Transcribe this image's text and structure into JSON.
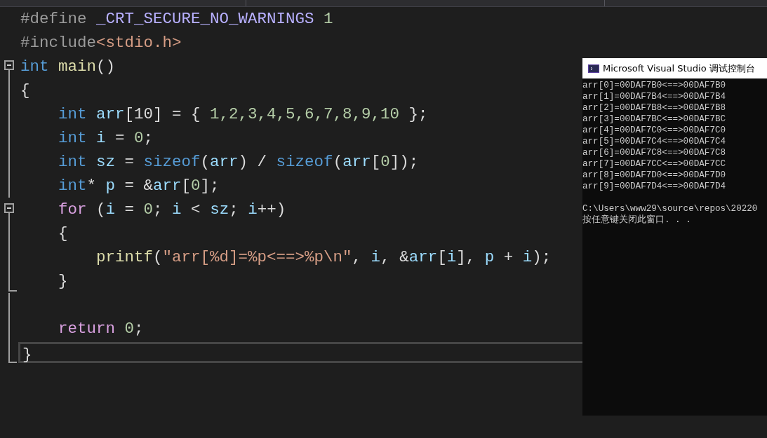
{
  "editor": {
    "lines": [
      {
        "kind": "plain",
        "current": false,
        "tokens": [
          {
            "kind": "pre",
            "text": "#define "
          },
          {
            "kind": "macro",
            "text": "_CRT_SECURE_NO_WARNINGS"
          },
          {
            "kind": "num",
            "text": " 1"
          }
        ]
      },
      {
        "kind": "plain",
        "current": false,
        "tokens": [
          {
            "kind": "pre",
            "text": "#include"
          },
          {
            "kind": "inc",
            "text": "<stdio.h>"
          }
        ]
      },
      {
        "kind": "fold-start",
        "expanded": true,
        "current": false,
        "tokens": [
          {
            "kind": "kw",
            "text": "int"
          },
          {
            "kind": "fn",
            "text": " main"
          },
          {
            "kind": "plain",
            "text": "()"
          }
        ]
      },
      {
        "kind": "fold-body",
        "current": false,
        "tokens": [
          {
            "kind": "plain",
            "text": "{"
          }
        ]
      },
      {
        "kind": "fold-body",
        "current": false,
        "tokens": [
          {
            "kind": "kw",
            "text": "    int"
          },
          {
            "kind": "var",
            "text": " arr"
          },
          {
            "kind": "plain",
            "text": "[10] = { "
          },
          {
            "kind": "num",
            "text": "1,2,3,4,5,6,7,8,9,10"
          },
          {
            "kind": "plain",
            "text": " };"
          }
        ]
      },
      {
        "kind": "fold-body",
        "current": false,
        "tokens": [
          {
            "kind": "kw",
            "text": "    int"
          },
          {
            "kind": "var",
            "text": " i"
          },
          {
            "kind": "plain",
            "text": " = "
          },
          {
            "kind": "num",
            "text": "0"
          },
          {
            "kind": "plain",
            "text": ";"
          }
        ]
      },
      {
        "kind": "fold-body",
        "current": false,
        "tokens": [
          {
            "kind": "kw",
            "text": "    int"
          },
          {
            "kind": "var",
            "text": " sz"
          },
          {
            "kind": "plain",
            "text": " = "
          },
          {
            "kind": "kw",
            "text": "sizeof"
          },
          {
            "kind": "plain",
            "text": "("
          },
          {
            "kind": "var",
            "text": "arr"
          },
          {
            "kind": "plain",
            "text": ") / "
          },
          {
            "kind": "kw",
            "text": "sizeof"
          },
          {
            "kind": "plain",
            "text": "("
          },
          {
            "kind": "var",
            "text": "arr"
          },
          {
            "kind": "plain",
            "text": "["
          },
          {
            "kind": "num",
            "text": "0"
          },
          {
            "kind": "plain",
            "text": "]);"
          }
        ]
      },
      {
        "kind": "fold-body",
        "current": false,
        "tokens": [
          {
            "kind": "kw",
            "text": "    int"
          },
          {
            "kind": "plain",
            "text": "* "
          },
          {
            "kind": "var",
            "text": "p"
          },
          {
            "kind": "plain",
            "text": " = &"
          },
          {
            "kind": "var",
            "text": "arr"
          },
          {
            "kind": "plain",
            "text": "["
          },
          {
            "kind": "num",
            "text": "0"
          },
          {
            "kind": "plain",
            "text": "];"
          }
        ]
      },
      {
        "kind": "fold-start",
        "expanded": true,
        "current": false,
        "tokens": [
          {
            "kind": "ctl",
            "text": "    for"
          },
          {
            "kind": "plain",
            "text": " ("
          },
          {
            "kind": "var",
            "text": "i"
          },
          {
            "kind": "plain",
            "text": " = "
          },
          {
            "kind": "num",
            "text": "0"
          },
          {
            "kind": "plain",
            "text": "; "
          },
          {
            "kind": "var",
            "text": "i"
          },
          {
            "kind": "plain",
            "text": " < "
          },
          {
            "kind": "var",
            "text": "sz"
          },
          {
            "kind": "plain",
            "text": "; "
          },
          {
            "kind": "var",
            "text": "i"
          },
          {
            "kind": "plain",
            "text": "++)"
          }
        ]
      },
      {
        "kind": "fold-body",
        "current": false,
        "tokens": [
          {
            "kind": "plain",
            "text": "    {"
          }
        ]
      },
      {
        "kind": "fold-body",
        "current": false,
        "tokens": [
          {
            "kind": "fn",
            "text": "        printf"
          },
          {
            "kind": "plain",
            "text": "("
          },
          {
            "kind": "str",
            "text": "\"arr[%d]=%p<==>%p\\n\""
          },
          {
            "kind": "plain",
            "text": ", "
          },
          {
            "kind": "var",
            "text": "i"
          },
          {
            "kind": "plain",
            "text": ", &"
          },
          {
            "kind": "var",
            "text": "arr"
          },
          {
            "kind": "plain",
            "text": "["
          },
          {
            "kind": "var",
            "text": "i"
          },
          {
            "kind": "plain",
            "text": "], "
          },
          {
            "kind": "var",
            "text": "p"
          },
          {
            "kind": "plain",
            "text": " + "
          },
          {
            "kind": "var",
            "text": "i"
          },
          {
            "kind": "plain",
            "text": ");"
          }
        ]
      },
      {
        "kind": "fold-end",
        "current": false,
        "tokens": [
          {
            "kind": "plain",
            "text": "    }"
          }
        ]
      },
      {
        "kind": "fold-body",
        "current": false
      },
      {
        "kind": "fold-body",
        "current": false,
        "tokens": [
          {
            "kind": "ctl",
            "text": "    return"
          },
          {
            "kind": "num",
            "text": " 0"
          },
          {
            "kind": "plain",
            "text": ";"
          }
        ]
      },
      {
        "kind": "fold-end",
        "current": true,
        "tokens": [
          {
            "kind": "plain",
            "text": "}"
          }
        ]
      }
    ]
  },
  "console": {
    "title": "Microsoft Visual Studio 调试控制台",
    "lines": [
      "arr[0]=00DAF7B0<==>00DAF7B0",
      "arr[1]=00DAF7B4<==>00DAF7B4",
      "arr[2]=00DAF7B8<==>00DAF7B8",
      "arr[3]=00DAF7BC<==>00DAF7BC",
      "arr[4]=00DAF7C0<==>00DAF7C0",
      "arr[5]=00DAF7C4<==>00DAF7C4",
      "arr[6]=00DAF7C8<==>00DAF7C8",
      "arr[7]=00DAF7CC<==>00DAF7CC",
      "arr[8]=00DAF7D0<==>00DAF7D0",
      "arr[9]=00DAF7D4<==>00DAF7D4"
    ],
    "footer": [
      "C:\\Users\\www29\\source\\repos\\20220",
      "按任意键关闭此窗口. . ."
    ]
  }
}
